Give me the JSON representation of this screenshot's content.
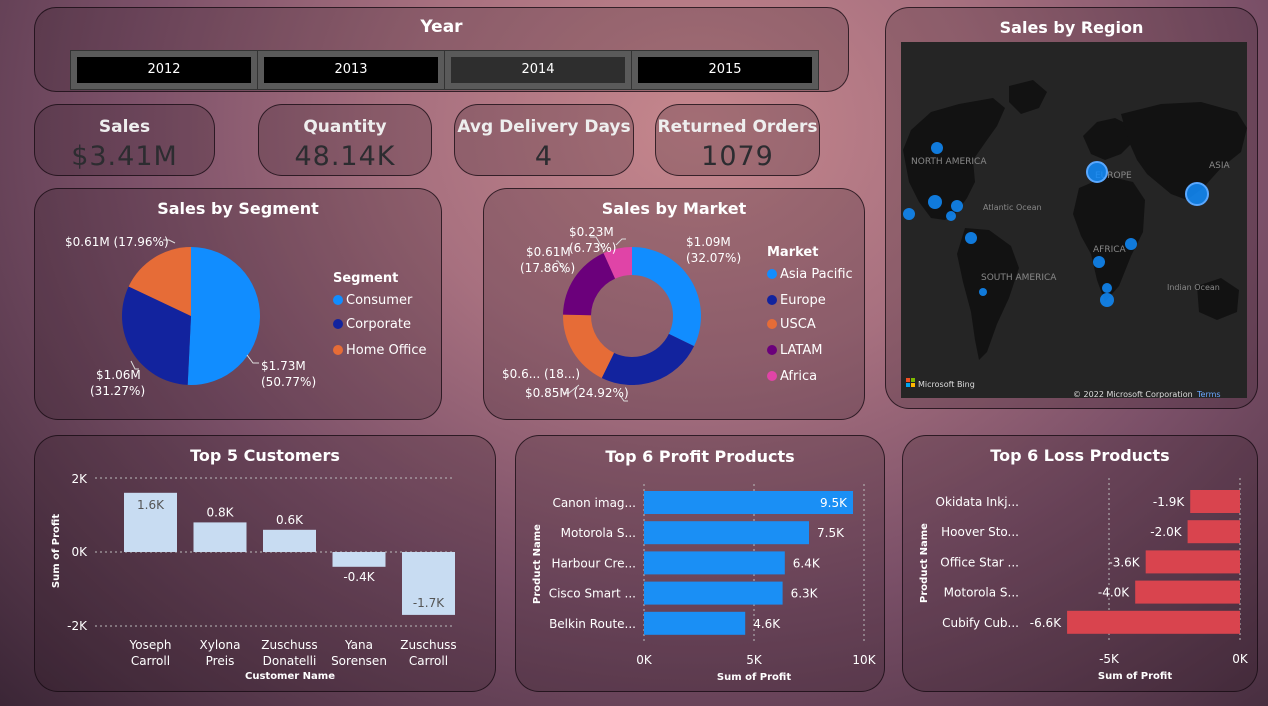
{
  "year_slicer": {
    "title": "Year",
    "options": [
      "2012",
      "2013",
      "2014",
      "2015"
    ],
    "selected": "2014"
  },
  "kpis": [
    {
      "label": "Sales",
      "value": "$3.41M"
    },
    {
      "label": "Quantity",
      "value": "48.14K"
    },
    {
      "label": "Avg Delivery Days",
      "value": "4"
    },
    {
      "label": "Returned Orders",
      "value": "1079"
    }
  ],
  "region_map": {
    "title": "Sales by Region",
    "labels": {
      "north_america": "NORTH AMERICA",
      "south_america": "SOUTH AMERICA",
      "europe": "EUROPE",
      "asia": "ASIA",
      "africa": "AFRICA",
      "atlantic": "Atlantic Ocean",
      "indian": "Indian Ocean"
    },
    "bing": "Microsoft Bing",
    "copyright": "© 2022 Microsoft Corporation",
    "terms": "Terms"
  },
  "colors": {
    "blue": "#118dff",
    "navy": "#12239e",
    "orange": "#e66c37",
    "purple": "#6b007b",
    "pink": "#e044a7",
    "profit_bar": "#1a8ff5",
    "loss_bar": "#d9444e",
    "customer_bar": "#c8dcf2"
  },
  "chart_data": [
    {
      "type": "pie",
      "title": "Sales by Segment",
      "legend_title": "Segment",
      "categories": [
        "Consumer",
        "Corporate",
        "Home Office"
      ],
      "values": [
        1.73,
        1.06,
        0.61
      ],
      "percent": [
        50.77,
        31.27,
        17.96
      ],
      "data_labels": [
        "$1.73M (50.77%)",
        "$1.06M (31.27%)",
        "$0.61M (17.96%)"
      ]
    },
    {
      "type": "pie",
      "subtype": "donut",
      "title": "Sales by Market",
      "legend_title": "Market",
      "categories": [
        "Asia Pacific",
        "Europe",
        "USCA",
        "LATAM",
        "Africa"
      ],
      "percent": [
        32.07,
        24.92,
        18.0,
        17.86,
        6.73
      ],
      "data_labels": [
        "$1.09M (32.07%)",
        "$0.85M (24.92%)",
        "$0.6... (18...)",
        "$0.61M (17.86%)",
        "$0.23M (6.73%)"
      ]
    },
    {
      "type": "bar",
      "title": "Top 5 Customers",
      "categories": [
        "Yoseph Carroll",
        "Xylona Preis",
        "Zuschuss Donatelli",
        "Yana Sorensen",
        "Zuschuss Carroll"
      ],
      "values": [
        1.6,
        0.8,
        0.6,
        -0.4,
        -1.7
      ],
      "value_labels": [
        "1.6K",
        "0.8K",
        "0.6K",
        "-0.4K",
        "-1.7K"
      ],
      "xlabel": "Customer Name",
      "ylabel": "Sum of Profit",
      "yticks": [
        "2K",
        "0K",
        "-2K"
      ],
      "ylim": [
        -2,
        2
      ]
    },
    {
      "type": "bar",
      "orientation": "horizontal",
      "title": "Top 6 Profit Products",
      "categories": [
        "Canon imag...",
        "Motorola S...",
        "Harbour Cre...",
        "Cisco Smart ...",
        "Belkin Route..."
      ],
      "values": [
        9.5,
        7.5,
        6.4,
        6.3,
        4.6
      ],
      "value_labels": [
        "9.5K",
        "7.5K",
        "6.4K",
        "6.3K",
        "4.6K"
      ],
      "xlabel": "Sum of Profit",
      "ylabel": "Product Name",
      "xticks": [
        "0K",
        "5K",
        "10K"
      ],
      "xlim": [
        0,
        10
      ]
    },
    {
      "type": "bar",
      "orientation": "horizontal",
      "title": "Top 6 Loss Products",
      "categories": [
        "Okidata Inkj...",
        "Hoover Sto...",
        "Office Star ...",
        "Motorola S...",
        "Cubify Cub..."
      ],
      "values": [
        -1.9,
        -2.0,
        -3.6,
        -4.0,
        -6.6
      ],
      "value_labels": [
        "-1.9K",
        "-2.0K",
        "-3.6K",
        "-4.0K",
        "-6.6K"
      ],
      "xlabel": "Sum of Profit",
      "ylabel": "Product Name",
      "xticks": [
        "-5K",
        "0K"
      ],
      "xlim": [
        -7.8,
        0
      ]
    }
  ]
}
